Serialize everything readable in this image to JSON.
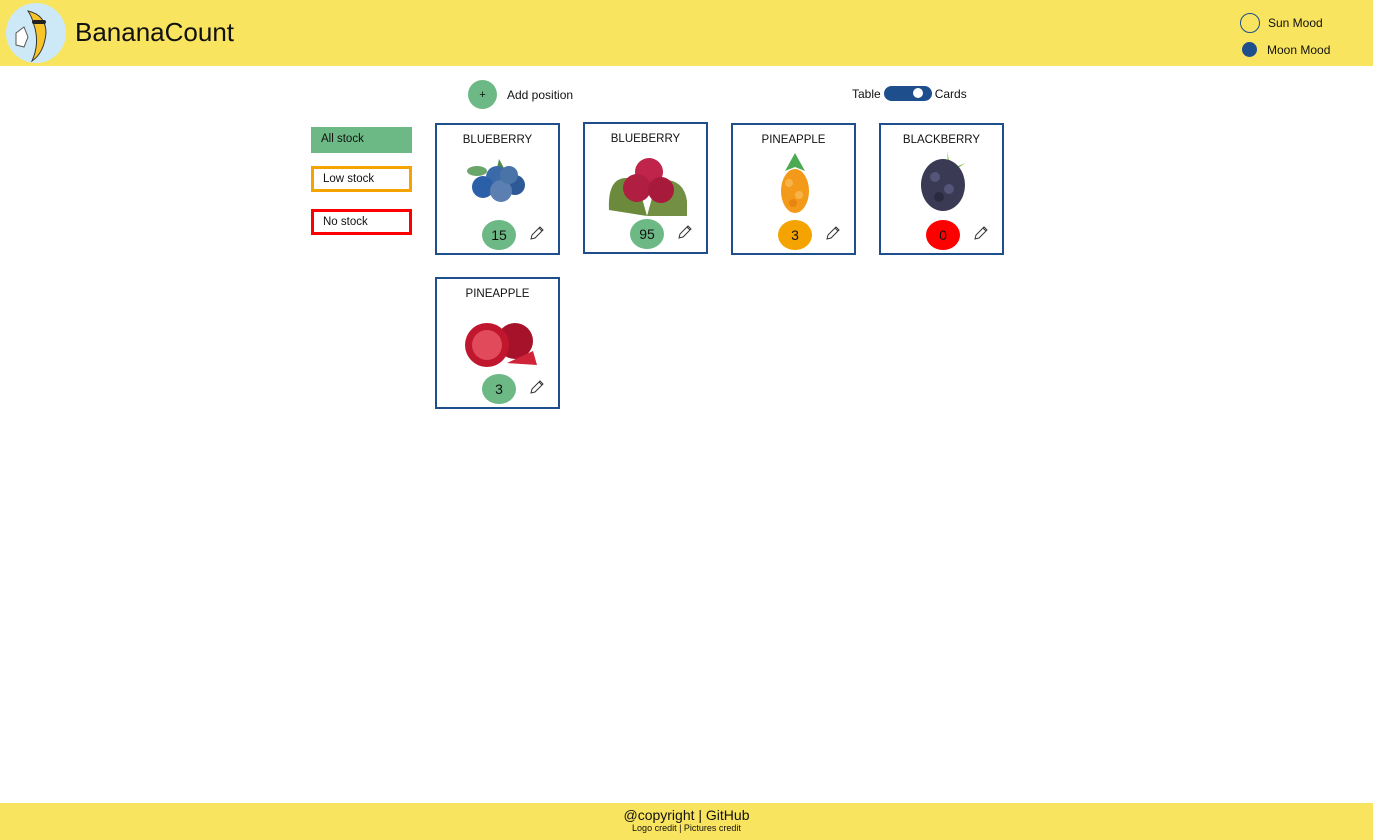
{
  "header": {
    "title": "BananaCount",
    "moods": [
      {
        "label": "Sun Mood"
      },
      {
        "label": "Moon Mood"
      }
    ]
  },
  "toolbar": {
    "add_label": "Add position",
    "add_icon": "+",
    "toggle_left": "Table",
    "toggle_right": "Cards",
    "toggle_state": "Cards"
  },
  "filters": [
    {
      "label": "All stock"
    },
    {
      "label": "Low stock"
    },
    {
      "label": "No stock"
    }
  ],
  "colors": {
    "header": "#f9e45f",
    "accent": "#1f4e8c",
    "ok": "#6db985",
    "low": "#f5a300",
    "none": "#ff0000"
  },
  "cards": [
    {
      "name": "BLUEBERRY",
      "count": "15",
      "status": "ok",
      "fruit": "blueberry"
    },
    {
      "name": "BLUEBERRY",
      "count": "95",
      "status": "ok",
      "fruit": "cranberry"
    },
    {
      "name": "PINEAPPLE",
      "count": "3",
      "status": "low",
      "fruit": "seabuckthorn"
    },
    {
      "name": "BLACKBERRY",
      "count": "0",
      "status": "none",
      "fruit": "blackberry"
    },
    {
      "name": "PINEAPPLE",
      "count": "3",
      "status": "ok",
      "fruit": "pomegranate"
    }
  ],
  "footer": {
    "line1": "@copyright | GitHub",
    "line2": "Logo credit | Pictures credit"
  }
}
